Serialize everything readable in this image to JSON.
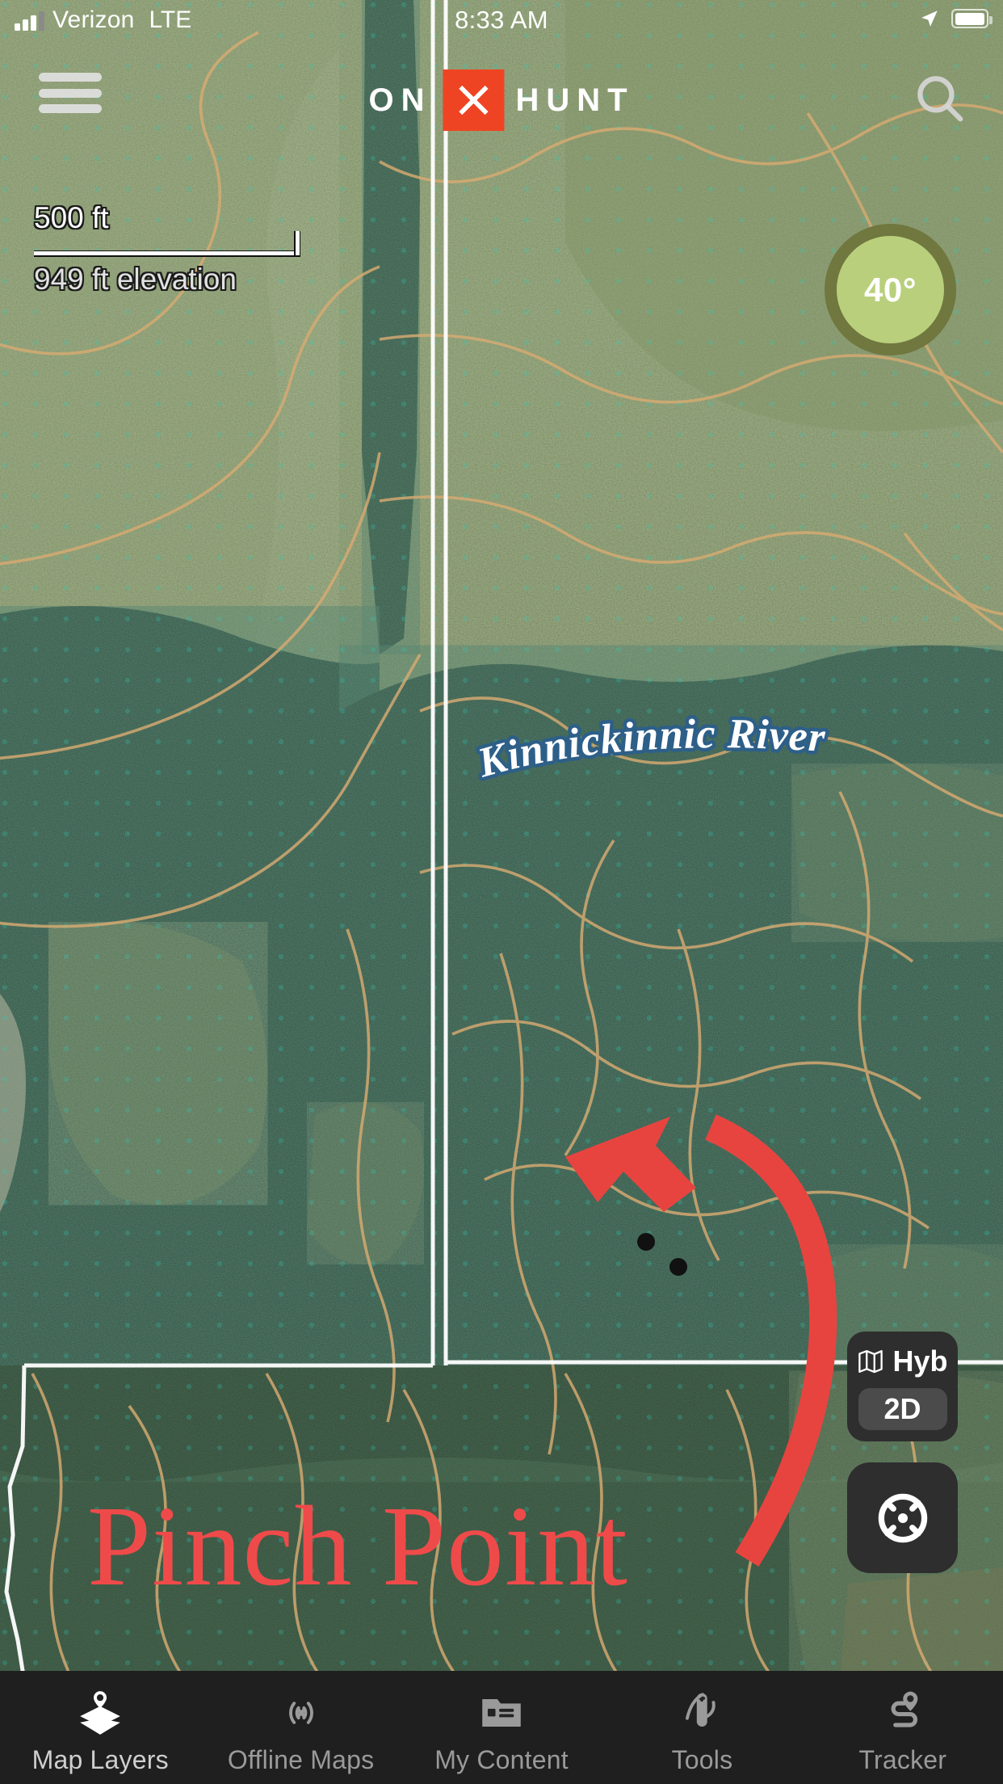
{
  "status_bar": {
    "carrier": "Verizon",
    "network": "LTE",
    "time": "8:33 AM",
    "signal_icon": "cellular-signal-icon",
    "location_icon": "location-arrow-icon",
    "battery_icon": "battery-full-icon"
  },
  "header": {
    "menu_icon": "hamburger-menu-icon",
    "logo_left": "ON",
    "logo_mark_icon": "x-mark-icon",
    "logo_right": "HUNT",
    "logo_mark_color": "#ef4423",
    "search_icon": "search-icon"
  },
  "map_info": {
    "scale_distance": "500 ft",
    "elevation": "949 ft elevation",
    "temperature": "40°",
    "temperature_fill": "#b9cf7c",
    "temperature_ring": "#70773f"
  },
  "map_labels": {
    "river": "Kinnickinnic River"
  },
  "map_controls": {
    "basemap_icon": "folded-map-icon",
    "basemap_label": "Hyb",
    "dimension_label": "2D",
    "locate_icon": "crosshair-locate-icon"
  },
  "annotations": {
    "pinch_point_label": "Pinch Point",
    "pinch_point_color": "#ef4a4a",
    "arrow_icon": "curved-arrow-icon",
    "arrow_color": "#e8443f",
    "waypoint_dots": 2
  },
  "bottom_nav": {
    "items": [
      {
        "label": "Map Layers",
        "icon": "map-layers-icon",
        "active": true
      },
      {
        "label": "Offline Maps",
        "icon": "offline-maps-icon",
        "active": false
      },
      {
        "label": "My Content",
        "icon": "my-content-icon",
        "active": false
      },
      {
        "label": "Tools",
        "icon": "tools-icon",
        "active": false
      },
      {
        "label": "Tracker",
        "icon": "tracker-icon",
        "active": false
      }
    ]
  }
}
